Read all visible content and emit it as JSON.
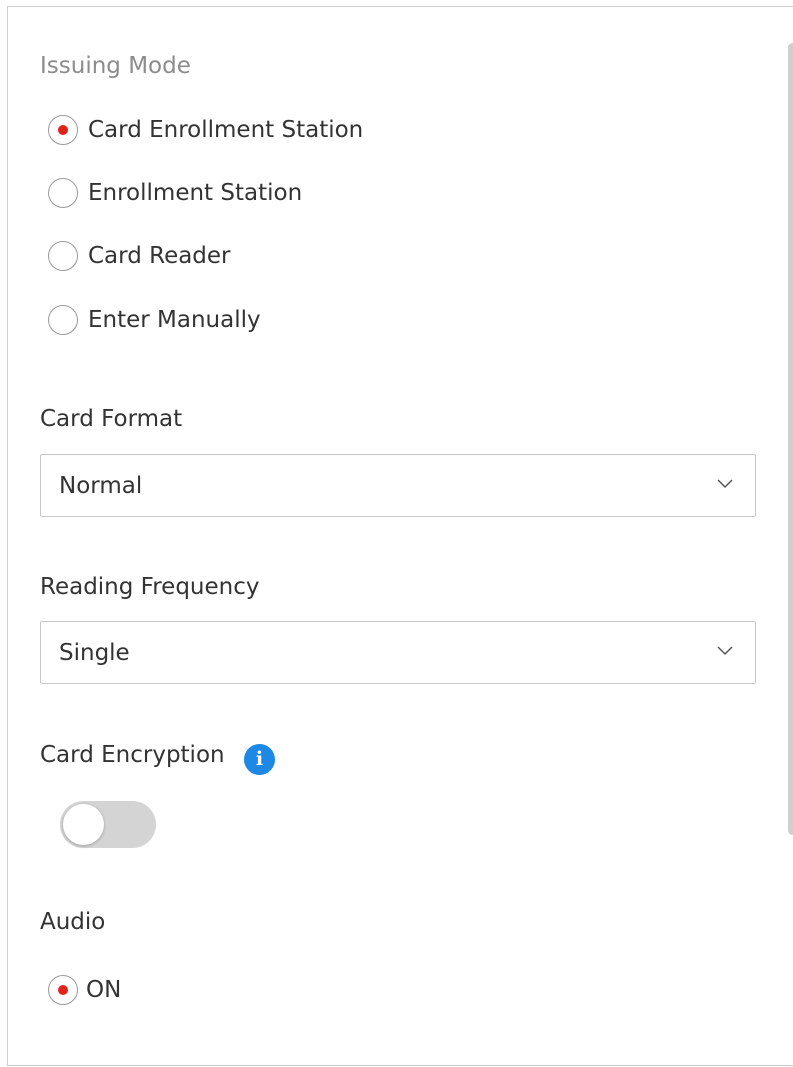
{
  "issuing_mode": {
    "label": "Issuing Mode",
    "options": [
      {
        "label": "Card Enrollment Station",
        "selected": true
      },
      {
        "label": "Enrollment Station",
        "selected": false
      },
      {
        "label": "Card Reader",
        "selected": false
      },
      {
        "label": "Enter Manually",
        "selected": false
      }
    ]
  },
  "card_format": {
    "label": "Card Format",
    "value": "Normal"
  },
  "reading_frequency": {
    "label": "Reading Frequency",
    "value": "Single"
  },
  "card_encryption": {
    "label": "Card Encryption",
    "info_icon": "info-icon",
    "enabled": false
  },
  "audio": {
    "label": "Audio",
    "option": {
      "label": "ON",
      "selected": true
    }
  },
  "colors": {
    "radio_selected": "#e2231a",
    "info_icon": "#1e88e5",
    "toggle_off": "#d4d4d4"
  }
}
